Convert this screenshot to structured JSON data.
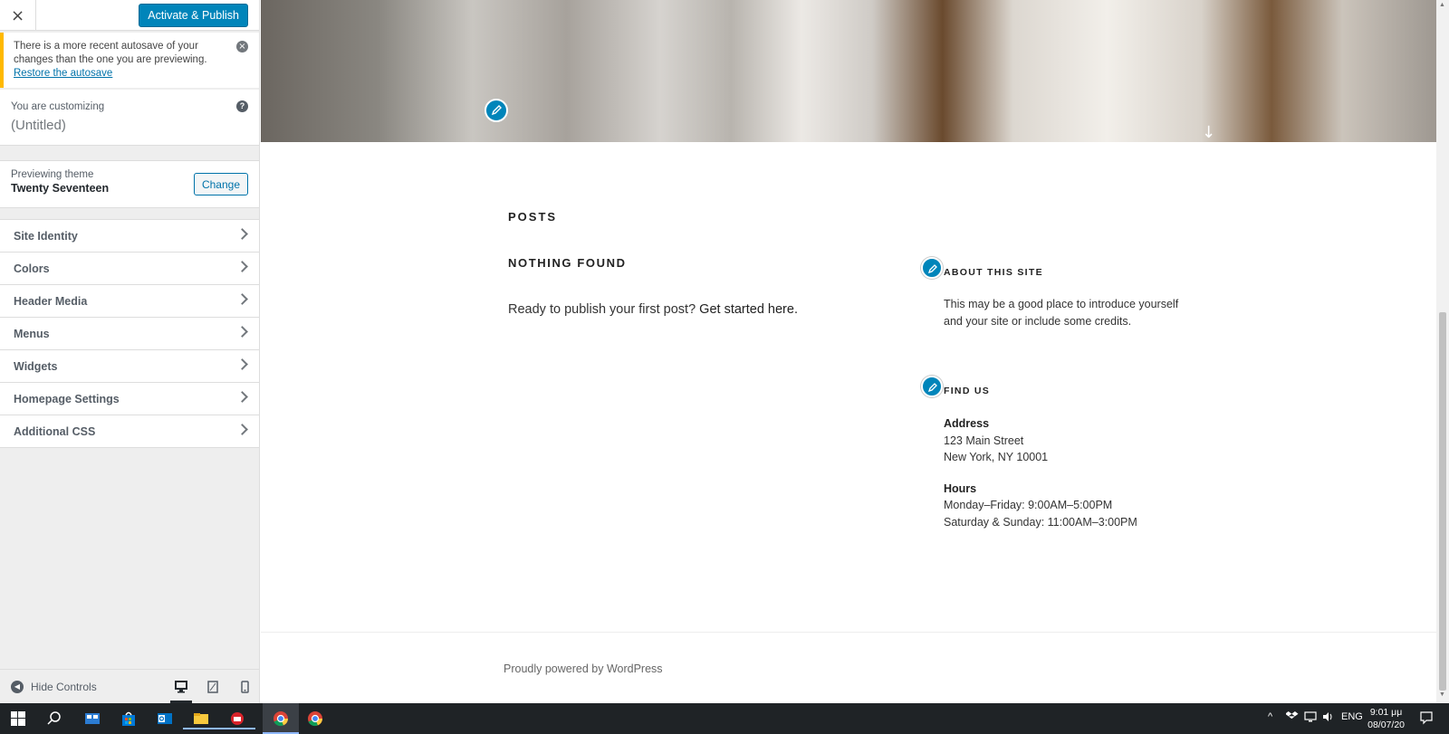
{
  "sidebar": {
    "close_label": "×",
    "publish_label": "Activate & Publish",
    "autosave": {
      "message": "There is a more recent autosave of your changes than the one you are previewing.",
      "link": "Restore the autosave",
      "dismiss": "×"
    },
    "customizing": {
      "label": "You are customizing",
      "title": "(Untitled)",
      "help": "?"
    },
    "theme": {
      "label": "Previewing theme",
      "name": "Twenty Seventeen",
      "change_label": "Change"
    },
    "sections": [
      {
        "label": "Site Identity"
      },
      {
        "label": "Colors"
      },
      {
        "label": "Header Media"
      },
      {
        "label": "Menus"
      },
      {
        "label": "Widgets"
      },
      {
        "label": "Homepage Settings"
      },
      {
        "label": "Additional CSS"
      }
    ],
    "footer": {
      "hide_label": "Hide Controls"
    }
  },
  "preview": {
    "posts_heading": "POSTS",
    "nothing_found": "NOTHING FOUND",
    "ready_text": "Ready to publish your first post?",
    "get_started": "Get started here.",
    "about": {
      "title": "ABOUT THIS SITE",
      "text": "This may be a good place to introduce yourself and your site or include some credits."
    },
    "find_us": {
      "title": "FIND US",
      "address_label": "Address",
      "address_line1": "123 Main Street",
      "address_line2": "New York, NY 10001",
      "hours_label": "Hours",
      "hours_line1": "Monday–Friday: 9:00AM–5:00PM",
      "hours_line2": "Saturday & Sunday: 11:00AM–3:00PM"
    },
    "powered_by": "Proudly powered by WordPress"
  },
  "taskbar": {
    "language": "ENG",
    "time": "9:01 μμ",
    "date": "08/07/20"
  },
  "colors": {
    "accent": "#0085ba",
    "autosave_border": "#ffb900",
    "taskbar": "#1f2326"
  },
  "icons": [
    "close-icon",
    "dismiss-icon",
    "help-icon",
    "chevron-right-icon",
    "pencil-icon",
    "arrow-down-icon",
    "hide-controls-icon",
    "desktop-icon",
    "tablet-icon",
    "mobile-icon",
    "windows-start-icon",
    "search-icon",
    "chrome-icon"
  ]
}
